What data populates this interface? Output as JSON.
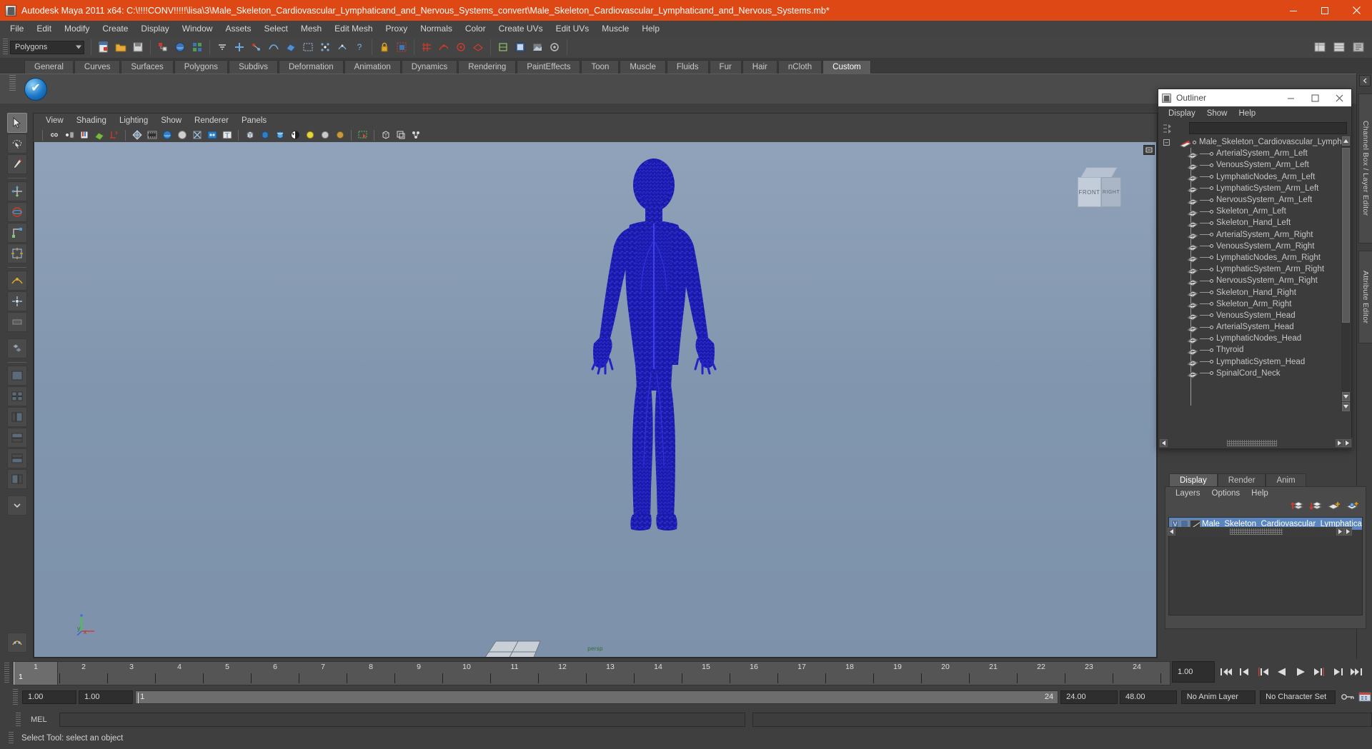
{
  "window": {
    "title": "Autodesk Maya 2011 x64: C:\\!!!!CONV!!!!!\\lisa\\3\\Male_Skeleton_Cardiovascular_Lymphaticand_and_Nervous_Systems_convert\\Male_Skeleton_Cardiovascular_Lymphaticand_and_Nervous_Systems.mb*",
    "app_icon": "maya-icon",
    "controls": {
      "minimize": "minimize-icon",
      "maximize": "maximize-icon",
      "close": "close-icon"
    },
    "accent_color": "#dd4814"
  },
  "menubar": {
    "items": [
      "File",
      "Edit",
      "Modify",
      "Create",
      "Display",
      "Window",
      "Assets",
      "Select",
      "Mesh",
      "Edit Mesh",
      "Proxy",
      "Normals",
      "Color",
      "Create UVs",
      "Edit UVs",
      "Muscle",
      "Help"
    ]
  },
  "statusline": {
    "mode_selector": {
      "value": "Polygons"
    },
    "icons": [
      "new-scene-icon",
      "open-scene-icon",
      "save-scene-icon",
      "undo-icon",
      "select-by-hierarchy-icon",
      "select-by-object-icon",
      "select-by-component-icon",
      "component-mask-icon",
      "points-mask-icon",
      "lines-mask-icon",
      "faces-mask-icon",
      "uvs-mask-icon",
      "vertices-mask-icon",
      "hulls-mask-icon",
      "help-mask-icon",
      "lock-icon",
      "highlight-icon",
      "snap-grid-icon",
      "snap-curve-icon",
      "snap-point-icon",
      "snap-view-icon",
      "snap-normal-icon",
      "construction-history-icon",
      "render-current-frame-icon",
      "ipr-render-icon",
      "render-settings-icon",
      "open-channel-box-icon",
      "open-layer-editor-icon",
      "open-attribute-editor-icon"
    ]
  },
  "shelf": {
    "tabs": [
      "General",
      "Curves",
      "Surfaces",
      "Polygons",
      "Subdivs",
      "Deformation",
      "Animation",
      "Dynamics",
      "Rendering",
      "PaintEffects",
      "Toon",
      "Muscle",
      "Fluids",
      "Fur",
      "Hair",
      "nCloth",
      "Custom"
    ],
    "active_tab": "Custom",
    "buttons": [
      "custom-script-icon"
    ]
  },
  "toolbox": {
    "tools": [
      "select-tool",
      "lasso-select-tool",
      "paint-select-tool",
      "move-tool",
      "rotate-tool",
      "scale-tool",
      "universal-manipulator-tool",
      "soft-modification-tool",
      "show-manipulator-tool",
      "last-tool",
      "layout-single-perspective",
      "layout-four-view",
      "layout-persp-outliner",
      "layout-persp-graph",
      "layout-hypershade-persp",
      "layout-persp-hypergraph",
      "layout-more",
      "bookmark-icon"
    ]
  },
  "viewport": {
    "menus": [
      "View",
      "Shading",
      "Lighting",
      "Show",
      "Renderer",
      "Panels"
    ],
    "toolbar_icons": [
      "select-camera-icon",
      "camera-attributes-icon",
      "bookmarks-icon",
      "image-plane-icon",
      "keyframe-icon",
      "wireframe-shading-icon",
      "smooth-shade-all-icon",
      "smooth-shade-textured-icon",
      "flat-shade-icon",
      "xray-icon",
      "xray-joints-icon",
      "texture-icon",
      "wireframe-on-shaded-icon",
      "hardware-texturing-icon",
      "hardware-lighting-icon",
      "smooth-wireframe-icon",
      "lights-default-icon",
      "lights-all-icon",
      "lights-quality-icon",
      "isolate-select-icon",
      "xray-mode-icon",
      "xray-joints-mode-icon",
      "shadow-icon"
    ],
    "view_cube": {
      "front_label": "FRONT",
      "right_label": "RIGHT"
    },
    "axis_labels": {
      "y": "y",
      "x": "x",
      "z": "z"
    },
    "hud_label": "persp",
    "background_top": "#90a2ba",
    "background_bottom": "#7d91ab",
    "model_color": "#1a1ab4",
    "collapse_button": "collapse-panel-icon"
  },
  "outliner": {
    "title": "Outliner",
    "icon": "outliner-icon",
    "controls": {
      "minimize": "minimize-icon",
      "maximize": "maximize-icon",
      "close": "close-icon"
    },
    "menus": [
      "Display",
      "Show",
      "Help"
    ],
    "search_value": "",
    "root": "Male_Skeleton_Cardiovascular_Lymphat",
    "items": [
      "ArterialSystem_Arm_Left",
      "VenousSystem_Arm_Left",
      "LymphaticNodes_Arm_Left",
      "LymphaticSystem_Arm_Left",
      "NervousSystem_Arm_Left",
      "Skeleton_Arm_Left",
      "Skeleton_Hand_Left",
      "ArterialSystem_Arm_Right",
      "VenousSystem_Arm_Right",
      "LymphaticNodes_Arm_Right",
      "LymphaticSystem_Arm_Right",
      "NervousSystem_Arm_Right",
      "Skeleton_Hand_Right",
      "Skeleton_Arm_Right",
      "VenousSystem_Head",
      "ArterialSystem_Head",
      "LymphaticNodes_Head",
      "Thyroid",
      "LymphaticSystem_Head",
      "SpinalCord_Neck"
    ]
  },
  "layer_editor": {
    "tabs": [
      "Display",
      "Render",
      "Anim"
    ],
    "active_tab": "Display",
    "menus": [
      "Layers",
      "Options",
      "Help"
    ],
    "tool_icons": [
      "move-layer-up-icon",
      "move-layer-down-icon",
      "new-layer-icon",
      "new-layer-from-selected-icon"
    ],
    "layers": [
      {
        "name": "Male_Skeleton_Cardiovascular_Lymphatica",
        "visible": "V",
        "playback": "",
        "selected": true
      }
    ]
  },
  "right_sidebar": {
    "tabs": [
      "Channel Box / Layer Editor",
      "Attribute Editor"
    ],
    "collapse": "collapse-icon"
  },
  "time_slider": {
    "ticks": [
      "1",
      "2",
      "3",
      "4",
      "5",
      "6",
      "7",
      "8",
      "9",
      "10",
      "11",
      "12",
      "13",
      "14",
      "15",
      "16",
      "17",
      "18",
      "19",
      "20",
      "21",
      "22",
      "23",
      "24"
    ],
    "current_frame": "1",
    "frame_field": "1.00",
    "playback_buttons": [
      "go-to-start-icon",
      "step-back-keyframe-icon",
      "step-back-frame-icon",
      "play-backwards-icon",
      "play-forwards-icon",
      "step-forward-frame-icon",
      "step-forward-keyframe-icon",
      "go-to-end-icon"
    ]
  },
  "range_slider": {
    "start_field": "1.00",
    "end_field": "1.00",
    "range_start": "1",
    "range_end": "24",
    "playback_end": "24.00",
    "animation_end": "48.00",
    "anim_layer": "No Anim Layer",
    "character_set": "No Character Set",
    "auto_key": "auto-keyframe-icon",
    "anim_prefs": "animation-preferences-icon"
  },
  "command_line": {
    "label": "MEL",
    "value": "",
    "output": ""
  },
  "help_line": {
    "text": "Select Tool: select an object"
  }
}
